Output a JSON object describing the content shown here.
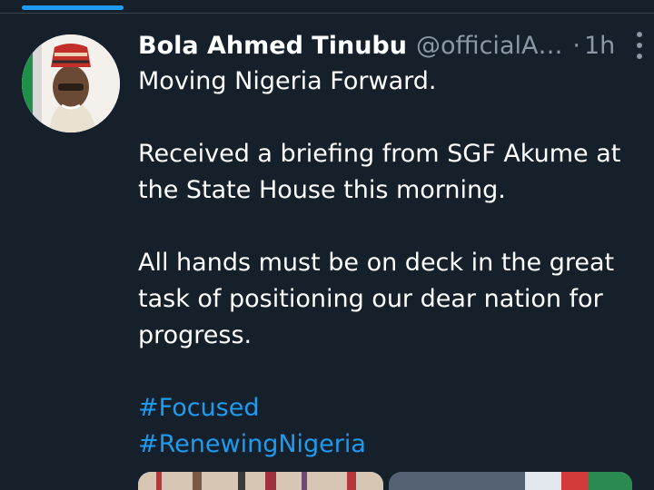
{
  "tweet": {
    "author_name": "Bola Ahmed Tinubu",
    "author_handle": "@officialABAT",
    "separator": "·",
    "time": "1h",
    "lines": [
      "Moving Nigeria Forward.",
      "Received a briefing from SGF Akume at the State House this morning.",
      "All hands must be on deck in the great task of positioning our dear nation for progress."
    ],
    "hashtags": [
      "#Focused",
      "#RenewingNigeria"
    ]
  },
  "icons": {
    "more": "more-vertical-icon",
    "avatar": "avatar-image"
  },
  "colors": {
    "background": "#15202b",
    "text": "#ffffff",
    "secondary_text": "#8b98a5",
    "accent": "#1d9bf0",
    "divider": "#38444d"
  }
}
